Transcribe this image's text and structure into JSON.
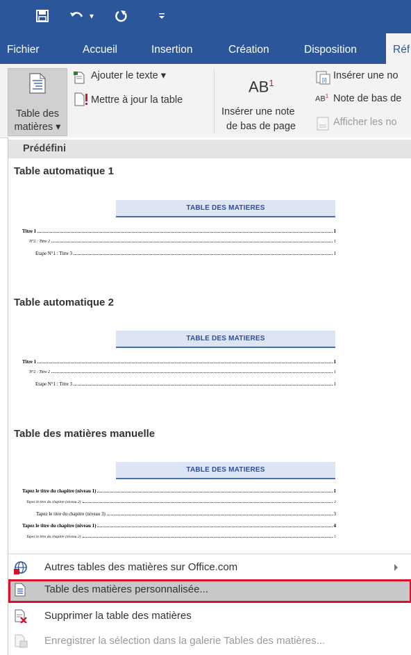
{
  "qat": {
    "save_icon": "save-icon",
    "undo_icon": "undo-icon",
    "undo_dropdown": "▾",
    "redo_icon": "redo-icon",
    "customize": "⯆"
  },
  "tabs": [
    "Fichier",
    "Accueil",
    "Insertion",
    "Création",
    "Disposition",
    "Réf"
  ],
  "ribbon": {
    "table_des_matieres": {
      "line1": "Table des",
      "line2": "matières ▾"
    },
    "ajouter_texte": "Ajouter le texte ▾",
    "mettre_a_jour": "Mettre à jour la table",
    "ab_label": "AB",
    "ab_sup": "1",
    "inserer_note_line1": "Insérer une note",
    "inserer_note_line2": "de bas de page",
    "inserer_une_no": "Insérer une no",
    "note_de_bas": "Note de bas de",
    "afficher_no": "Afficher les no"
  },
  "menu": {
    "section": "Prédéfini",
    "galleries": [
      {
        "title": "Table automatique 1",
        "banner": "TABLE DES MATIERES",
        "rows": [
          {
            "text": "Titre 1",
            "page": "1"
          },
          {
            "text": "N°2 :    Titre 2",
            "page": "1"
          },
          {
            "text": "Etape N°1 :   Titre 3",
            "page": "1"
          }
        ]
      },
      {
        "title": "Table automatique 2",
        "banner": "TABLE DES MATIERES",
        "rows": [
          {
            "text": "Titre 1",
            "page": "1"
          },
          {
            "text": "N°2 :    Titre 2",
            "page": "1"
          },
          {
            "text": "Etape N°1 :   Titre 3",
            "page": "1"
          }
        ]
      },
      {
        "title": "Table des matières manuelle",
        "banner": "TABLE DES MATIERES",
        "rows": [
          {
            "text": "Tapez le titre du chapitre (niveau 1)",
            "page": "1"
          },
          {
            "text": "Tapez le titre du chapitre (niveau 2)",
            "page": "2"
          },
          {
            "text": "Tapez le titre du chapitre (niveau 3)",
            "page": "3"
          },
          {
            "text": "Tapez le titre du chapitre (niveau 1)",
            "page": "4"
          },
          {
            "text": "Tapez le titre du chapitre (niveau 2)",
            "page": "5"
          }
        ]
      }
    ],
    "items": [
      {
        "label": "Autres tables des matières sur Office.com",
        "icon": "office-globe-icon"
      },
      {
        "label": "Table des matières personnalisée...",
        "icon": "document-icon"
      },
      {
        "label": "Supprimer la table des matières",
        "icon": "delete-document-icon"
      },
      {
        "label": "Enregistrer la sélection dans la galerie Tables des matières...",
        "icon": "save-to-gallery-icon"
      }
    ]
  },
  "colors": {
    "ribbon_blue": "#2b579a",
    "highlight_border": "#d3132a"
  }
}
